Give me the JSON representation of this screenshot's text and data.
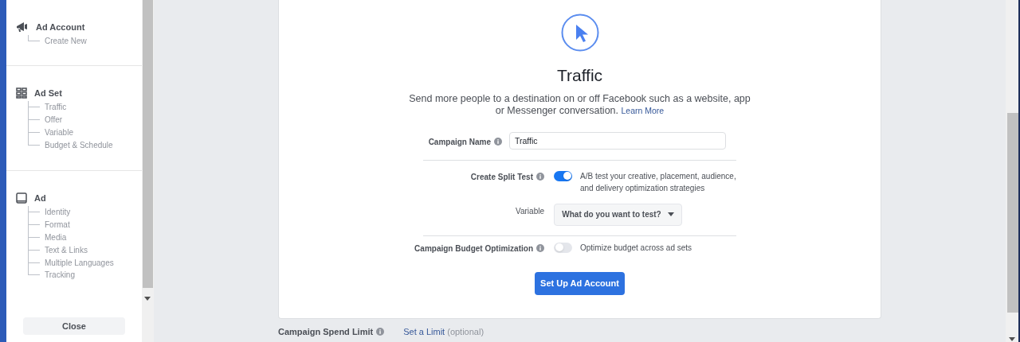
{
  "sidebar": {
    "sections": [
      {
        "kind": "megaphone",
        "title": "Ad Account",
        "children": [
          {
            "label": "Create New"
          }
        ]
      },
      {
        "kind": "grid",
        "title": "Ad Set",
        "children": [
          {
            "label": "Traffic"
          },
          {
            "label": "Offer"
          },
          {
            "label": "Variable"
          },
          {
            "label": "Budget & Schedule"
          }
        ]
      },
      {
        "kind": "tablet",
        "title": "Ad",
        "children": [
          {
            "label": "Identity"
          },
          {
            "label": "Format"
          },
          {
            "label": "Media"
          },
          {
            "label": "Text & Links"
          },
          {
            "label": "Multiple Languages"
          },
          {
            "label": "Tracking"
          }
        ]
      }
    ],
    "close_button": "Close"
  },
  "objective": {
    "title": "Traffic",
    "description": "Send more people to a destination on or off Facebook such as a website, app or Messenger conversation.",
    "learn_more": "Learn More"
  },
  "form": [
    {
      "kind": "text",
      "label": "Campaign Name",
      "info": true,
      "value": "Traffic"
    },
    {
      "kind": "toggle",
      "label": "Create Split Test",
      "info": true,
      "on": true,
      "text": "A/B test your creative, placement, audience, and delivery optimization strategies"
    },
    {
      "kind": "dropdown",
      "label": "Variable",
      "info": false,
      "value": "What do you want to test?"
    },
    {
      "kind": "toggle",
      "label": "Campaign Budget Optimization",
      "info": true,
      "on": false,
      "text": "Optimize budget across ad sets"
    }
  ],
  "submit_button": "Set Up Ad Account",
  "spend_limit": {
    "label": "Campaign Spend Limit",
    "link": "Set a Limit",
    "note": "(optional)"
  }
}
